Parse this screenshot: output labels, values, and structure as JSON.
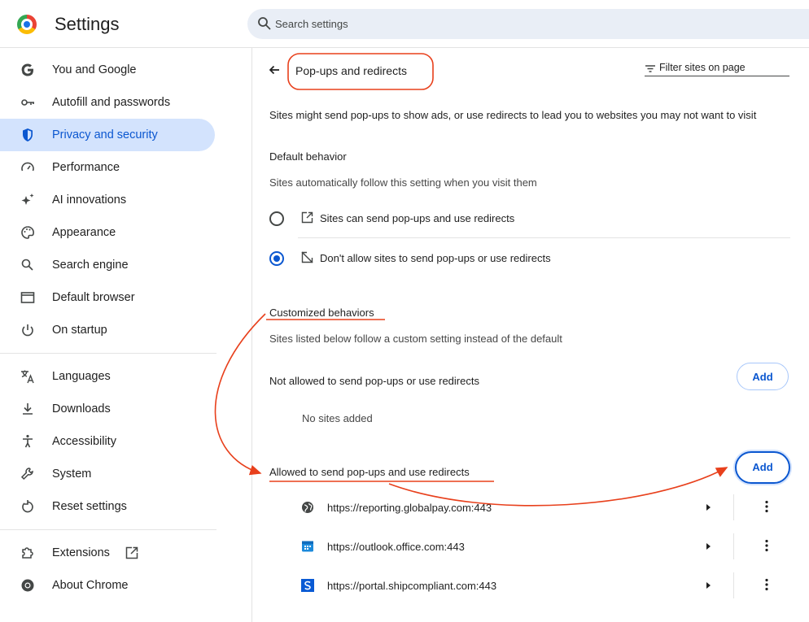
{
  "header": {
    "app_title": "Settings",
    "search_placeholder": "Search settings"
  },
  "sidebar": {
    "items": [
      {
        "label": "You and Google",
        "icon": "google-g-icon"
      },
      {
        "label": "Autofill and passwords",
        "icon": "key-icon"
      },
      {
        "label": "Privacy and security",
        "icon": "shield-icon",
        "active": true
      },
      {
        "label": "Performance",
        "icon": "speedometer-icon"
      },
      {
        "label": "AI innovations",
        "icon": "sparkle-icon"
      },
      {
        "label": "Appearance",
        "icon": "palette-icon"
      },
      {
        "label": "Search engine",
        "icon": "search-icon"
      },
      {
        "label": "Default browser",
        "icon": "browser-window-icon"
      },
      {
        "label": "On startup",
        "icon": "power-icon"
      },
      {
        "label": "Languages",
        "icon": "translate-icon"
      },
      {
        "label": "Downloads",
        "icon": "download-icon"
      },
      {
        "label": "Accessibility",
        "icon": "accessibility-icon"
      },
      {
        "label": "System",
        "icon": "wrench-icon"
      },
      {
        "label": "Reset settings",
        "icon": "reset-icon"
      },
      {
        "label": "Extensions",
        "icon": "puzzle-icon"
      },
      {
        "label": "About Chrome",
        "icon": "chrome-icon"
      }
    ]
  },
  "main": {
    "title": "Pop-ups and redirects",
    "filter_label": "Filter sites on page",
    "description": "Sites might send pop-ups to show ads, or use redirects to lead you to websites you may not want to visit",
    "default_behavior": {
      "heading": "Default behavior",
      "subtext": "Sites automatically follow this setting when you visit them",
      "options": [
        {
          "label": "Sites can send pop-ups and use redirects",
          "selected": false
        },
        {
          "label": "Don't allow sites to send pop-ups or use redirects",
          "selected": true
        }
      ]
    },
    "customized": {
      "heading": "Customized behaviors",
      "subtext": "Sites listed below follow a custom setting instead of the default",
      "not_allowed_label": "Not allowed to send pop-ups or use redirects",
      "add_label": "Add",
      "no_sites": "No sites added",
      "allowed_label": "Allowed to send pop-ups and use redirects",
      "allowed_sites": [
        {
          "url": "https://reporting.globalpay.com:443",
          "icon": "globe-icon"
        },
        {
          "url": "https://outlook.office.com:443",
          "icon": "calendar-favicon-icon"
        },
        {
          "url": "https://portal.shipcompliant.com:443",
          "icon": "s-favicon-icon"
        }
      ]
    }
  },
  "colors": {
    "accent": "#0b57d0",
    "active_bg": "#d3e3fd",
    "annotation": "#e8401c"
  }
}
